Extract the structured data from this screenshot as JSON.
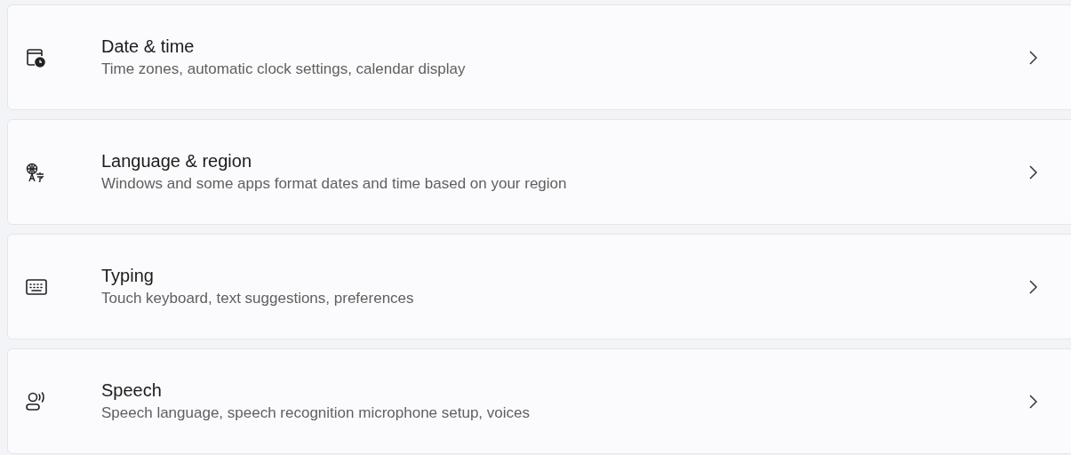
{
  "settings_items": [
    {
      "title": "Date & time",
      "description": "Time zones, automatic clock settings, calendar display"
    },
    {
      "title": "Language & region",
      "description": "Windows and some apps format dates and time based on your region"
    },
    {
      "title": "Typing",
      "description": "Touch keyboard, text suggestions, preferences"
    },
    {
      "title": "Speech",
      "description": "Speech language, speech recognition microphone setup, voices"
    }
  ]
}
